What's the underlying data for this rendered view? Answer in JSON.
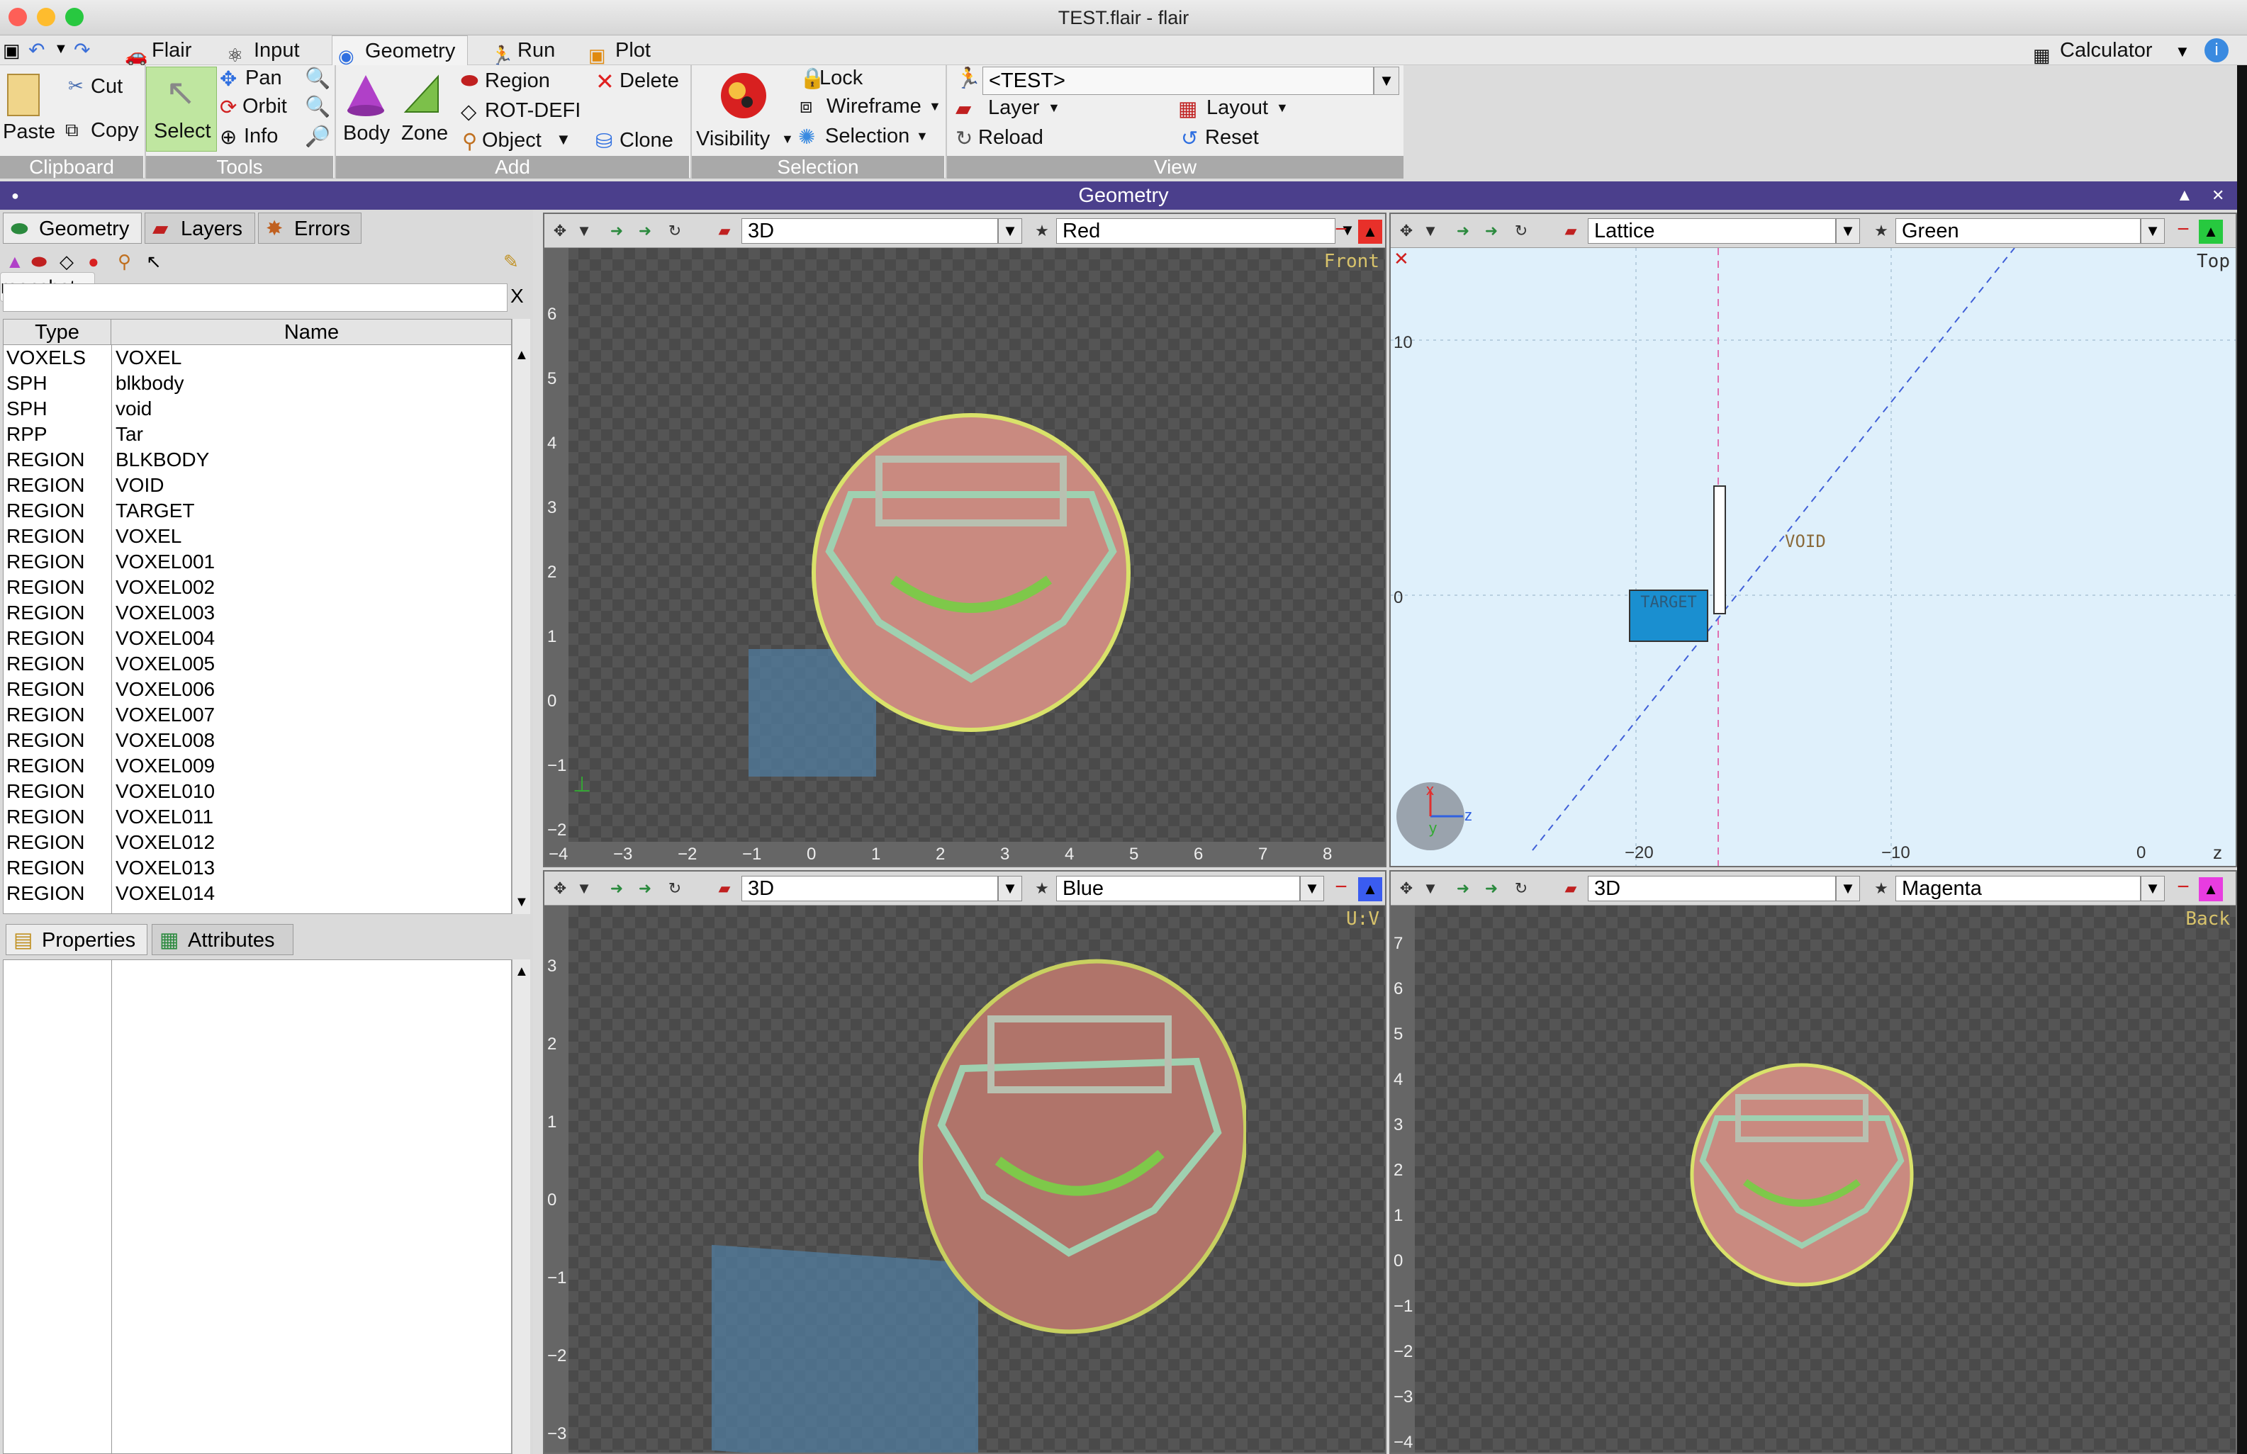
{
  "window": {
    "title": "TEST.flair - flair",
    "colors": {
      "close": "#fe5f57",
      "minimize": "#febc2e",
      "zoom": "#28c840"
    }
  },
  "menu": {
    "tabs": [
      {
        "label": "Flair"
      },
      {
        "label": "Input"
      },
      {
        "label": "Geometry"
      },
      {
        "label": "Run"
      },
      {
        "label": "Plot"
      }
    ],
    "calculator": "Calculator"
  },
  "ribbon": {
    "clipboard": {
      "paste": "Paste",
      "cut": "Cut",
      "copy": "Copy",
      "group": "Clipboard"
    },
    "tools": {
      "select": "Select",
      "pan": "Pan",
      "orbit": "Orbit",
      "info": "Info",
      "group": "Tools"
    },
    "add": {
      "body": "Body",
      "zone": "Zone",
      "region": "Region",
      "rotdefi": "ROT-DEFI",
      "object": "Object",
      "delete": "Delete",
      "clone": "Clone",
      "group": "Add"
    },
    "selection": {
      "visibility": "Visibility",
      "lock": "Lock",
      "wireframe": "Wireframe",
      "selection": "Selection",
      "group": "Selection"
    },
    "view": {
      "test": "<TEST>",
      "layer": "Layer",
      "layout": "Layout",
      "reload": "Reload",
      "reset": "Reset",
      "group": "View"
    }
  },
  "geometry_header": "Geometry",
  "left": {
    "tabs": [
      {
        "label": "Geometry"
      },
      {
        "label": "Layers"
      },
      {
        "label": "Errors"
      }
    ],
    "tooltip": "reenshot",
    "filter_clear": "X",
    "columns": [
      "Type",
      "Name"
    ],
    "rows": [
      {
        "type": "VOXELS",
        "name": "VOXEL"
      },
      {
        "type": "SPH",
        "name": "blkbody"
      },
      {
        "type": "SPH",
        "name": "void"
      },
      {
        "type": "RPP",
        "name": "Tar"
      },
      {
        "type": "REGION",
        "name": "BLKBODY"
      },
      {
        "type": "REGION",
        "name": "VOID"
      },
      {
        "type": "REGION",
        "name": "TARGET"
      },
      {
        "type": "REGION",
        "name": "VOXEL"
      },
      {
        "type": "REGION",
        "name": "VOXEL001"
      },
      {
        "type": "REGION",
        "name": "VOXEL002"
      },
      {
        "type": "REGION",
        "name": "VOXEL003"
      },
      {
        "type": "REGION",
        "name": "VOXEL004"
      },
      {
        "type": "REGION",
        "name": "VOXEL005"
      },
      {
        "type": "REGION",
        "name": "VOXEL006"
      },
      {
        "type": "REGION",
        "name": "VOXEL007"
      },
      {
        "type": "REGION",
        "name": "VOXEL008"
      },
      {
        "type": "REGION",
        "name": "VOXEL009"
      },
      {
        "type": "REGION",
        "name": "VOXEL010"
      },
      {
        "type": "REGION",
        "name": "VOXEL011"
      },
      {
        "type": "REGION",
        "name": "VOXEL012"
      },
      {
        "type": "REGION",
        "name": "VOXEL013"
      },
      {
        "type": "REGION",
        "name": "VOXEL014"
      }
    ],
    "bottom_tabs": [
      {
        "label": "Properties"
      },
      {
        "label": "Attributes"
      }
    ]
  },
  "viewports": [
    {
      "mode": "3D",
      "color": "Red",
      "accent": "#e8302a",
      "label": "Front",
      "yticks": [
        "6",
        "5",
        "4",
        "3",
        "2",
        "1",
        "0",
        "−1",
        "−2"
      ],
      "xticks": [
        "−4",
        "−3",
        "−2",
        "−1",
        "0",
        "1",
        "2",
        "3",
        "4",
        "5",
        "6",
        "7",
        "8"
      ]
    },
    {
      "mode": "Lattice",
      "color": "Green",
      "accent": "#27c93f",
      "label": "Top",
      "yticks": [
        "10",
        "0"
      ],
      "xticks": [
        "−20",
        "−10",
        "0"
      ],
      "void_label": "VOID",
      "target_label": "TARGET",
      "axis_z": "z",
      "axis_x": "x",
      "axis_y": "y"
    },
    {
      "mode": "3D",
      "color": "Blue",
      "accent": "#3a5cf0",
      "label": "U:V",
      "yticks": [
        "3",
        "2",
        "1",
        "0",
        "−1",
        "−2",
        "−3"
      ]
    },
    {
      "mode": "3D",
      "color": "Magenta",
      "accent": "#e83ce0",
      "label": "Back",
      "yticks": [
        "7",
        "6",
        "5",
        "4",
        "3",
        "2",
        "1",
        "0",
        "−1",
        "−2",
        "−3",
        "−4"
      ]
    }
  ]
}
